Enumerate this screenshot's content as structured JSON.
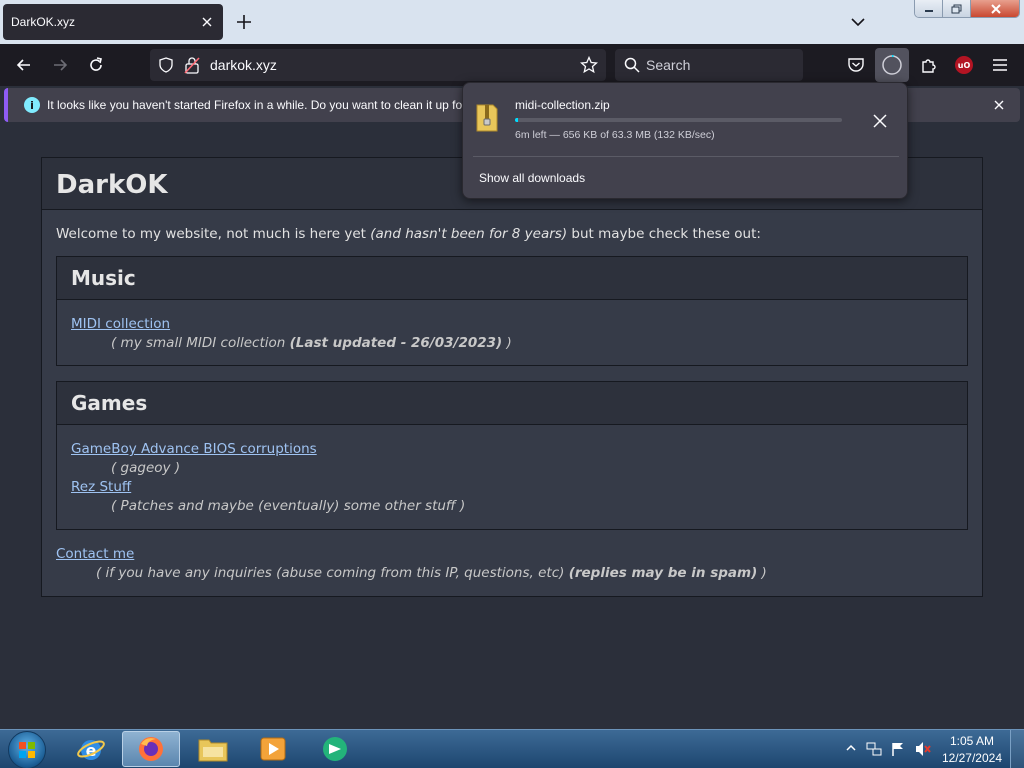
{
  "browser": {
    "tab": {
      "title": "DarkOK.xyz"
    },
    "url": "darkok.xyz",
    "search_placeholder": "Search",
    "extension_badge": "uO",
    "notification": "It looks like you haven't started Firefox in a while. Do you want to clean it up for"
  },
  "downloads": {
    "file_name": "midi-collection.zip",
    "status": "6m left — 656 KB of 63.3 MB (132 KB/sec)",
    "progress_fraction": 0.01,
    "show_all": "Show all downloads"
  },
  "site": {
    "title": "DarkOK",
    "intro_prefix": "Welcome to my website, not much is here yet ",
    "intro_italic": "(and hasn't been for 8 years)",
    "intro_suffix": " but maybe check these out:",
    "sections": [
      {
        "title": "Music",
        "entries": [
          {
            "link": "MIDI collection",
            "desc": "( my small MIDI collection ",
            "desc_bold": "(Last updated - 26/03/2023)",
            "desc_end": " )"
          }
        ]
      },
      {
        "title": "Games",
        "entries": [
          {
            "link": "GameBoy Advance BIOS corruptions",
            "desc": "( gageoy )"
          },
          {
            "link": "Rez Stuff",
            "desc": "( Patches and maybe (eventually) some other stuff )"
          }
        ]
      }
    ],
    "contact": {
      "link": "Contact me",
      "desc": "( if you have any inquiries (abuse coming from this IP, questions, etc) ",
      "desc_bold": "(replies may be in spam)",
      "desc_end": " )"
    }
  },
  "taskbar": {
    "time": "1:05 AM",
    "date": "12/27/2024"
  },
  "colors": {
    "accent_link": "#9fc3f2",
    "progress": "#00ddff",
    "notice_accent": "#8f5cf5"
  }
}
